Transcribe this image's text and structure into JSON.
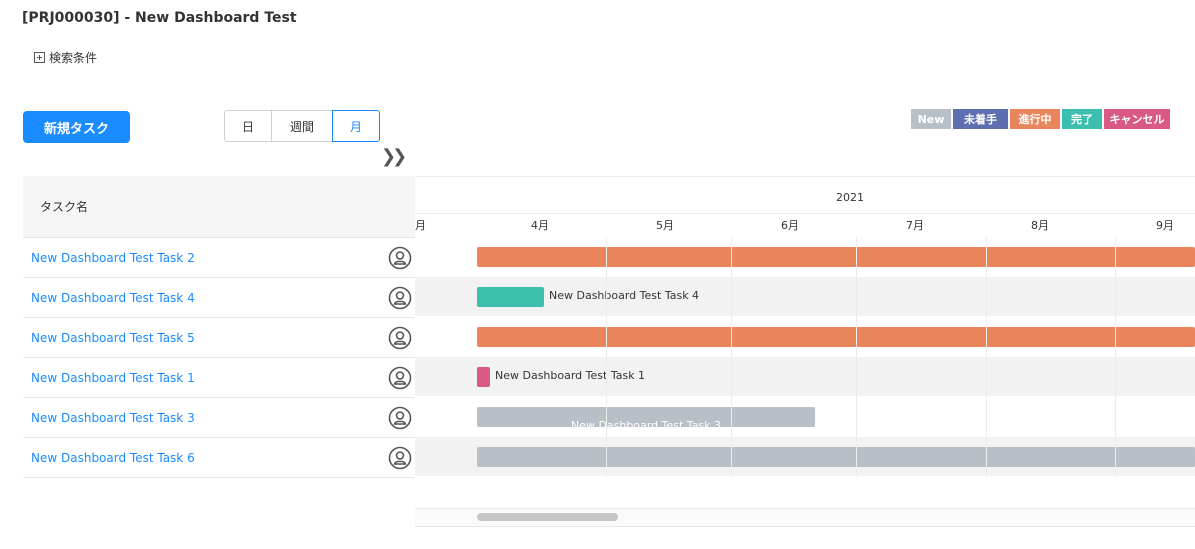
{
  "page": {
    "title": "[PRJ000030] - New Dashboard Test",
    "filter_toggle_label": "検索条件"
  },
  "toolbar": {
    "new_task_label": "新規タスク",
    "view_options": [
      "日",
      "週間",
      "月"
    ],
    "selected_view": "月",
    "expand_icon": "double-chevron-right-icon"
  },
  "legend": [
    {
      "label": "New",
      "color": "#b8bfc7"
    },
    {
      "label": "未着手",
      "color": "#5d6fb0"
    },
    {
      "label": "進行中",
      "color": "#e8855a"
    },
    {
      "label": "完了",
      "color": "#3dbfb0"
    },
    {
      "label": "キャンセル",
      "color": "#d95a84"
    }
  ],
  "grid": {
    "column_header": "タスク名",
    "rows": [
      {
        "name": "New Dashboard Test Task 2",
        "status": "進行中"
      },
      {
        "name": "New Dashboard Test Task 4",
        "status": "完了"
      },
      {
        "name": "New Dashboard Test Task 5",
        "status": "進行中"
      },
      {
        "name": "New Dashboard Test Task 1",
        "status": "キャンセル"
      },
      {
        "name": "New Dashboard Test Task 3",
        "status": "New"
      },
      {
        "name": "New Dashboard Test Task 6",
        "status": "New"
      }
    ]
  },
  "timeline": {
    "year": "2021",
    "months": [
      "月",
      "4月",
      "5月",
      "6月",
      "7月",
      "8月",
      "9月"
    ],
    "bar_labels": {
      "task4": "New Dashboard Test Task 4",
      "task1": "New Dashboard Test Task 1",
      "task3": "New Dashboard Test Task 3"
    }
  }
}
